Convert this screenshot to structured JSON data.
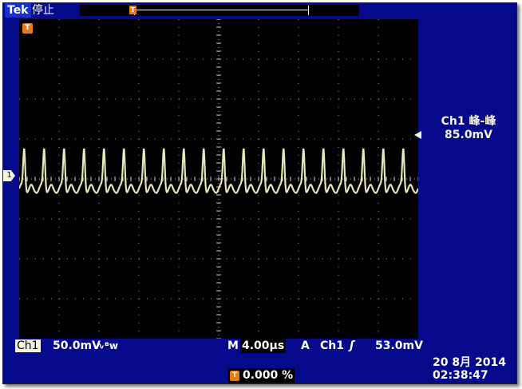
{
  "statusbar": {
    "brand": "Tek",
    "run_state": "停止"
  },
  "record_trigger_icon": "T",
  "screen_trigger_icon": "T",
  "ch1_marker_label": "1",
  "measurement": {
    "title": "Ch1 峰-峰",
    "value": "85.0mV"
  },
  "bottom": {
    "ch_label": "Ch1",
    "volts_div": "50.0mV",
    "coupling_symbol": "∿ᴮw",
    "m_label": "M",
    "time_div": "4.00µs",
    "trig_mode": "A",
    "trig_source": "Ch1",
    "trig_slope": "ʃ",
    "trig_level": "53.0mV",
    "trig_pos_icon": "T",
    "trig_pos": "0.000 %",
    "date": "20 8月  2014",
    "time": "02:38:47"
  },
  "colors": {
    "background": "#050a8c",
    "screen": "#000000",
    "trace": "#f2f2b0",
    "accent": "#e87a1a"
  },
  "waveform": {
    "cycles": 20,
    "peak_fraction": 0.94
  }
}
